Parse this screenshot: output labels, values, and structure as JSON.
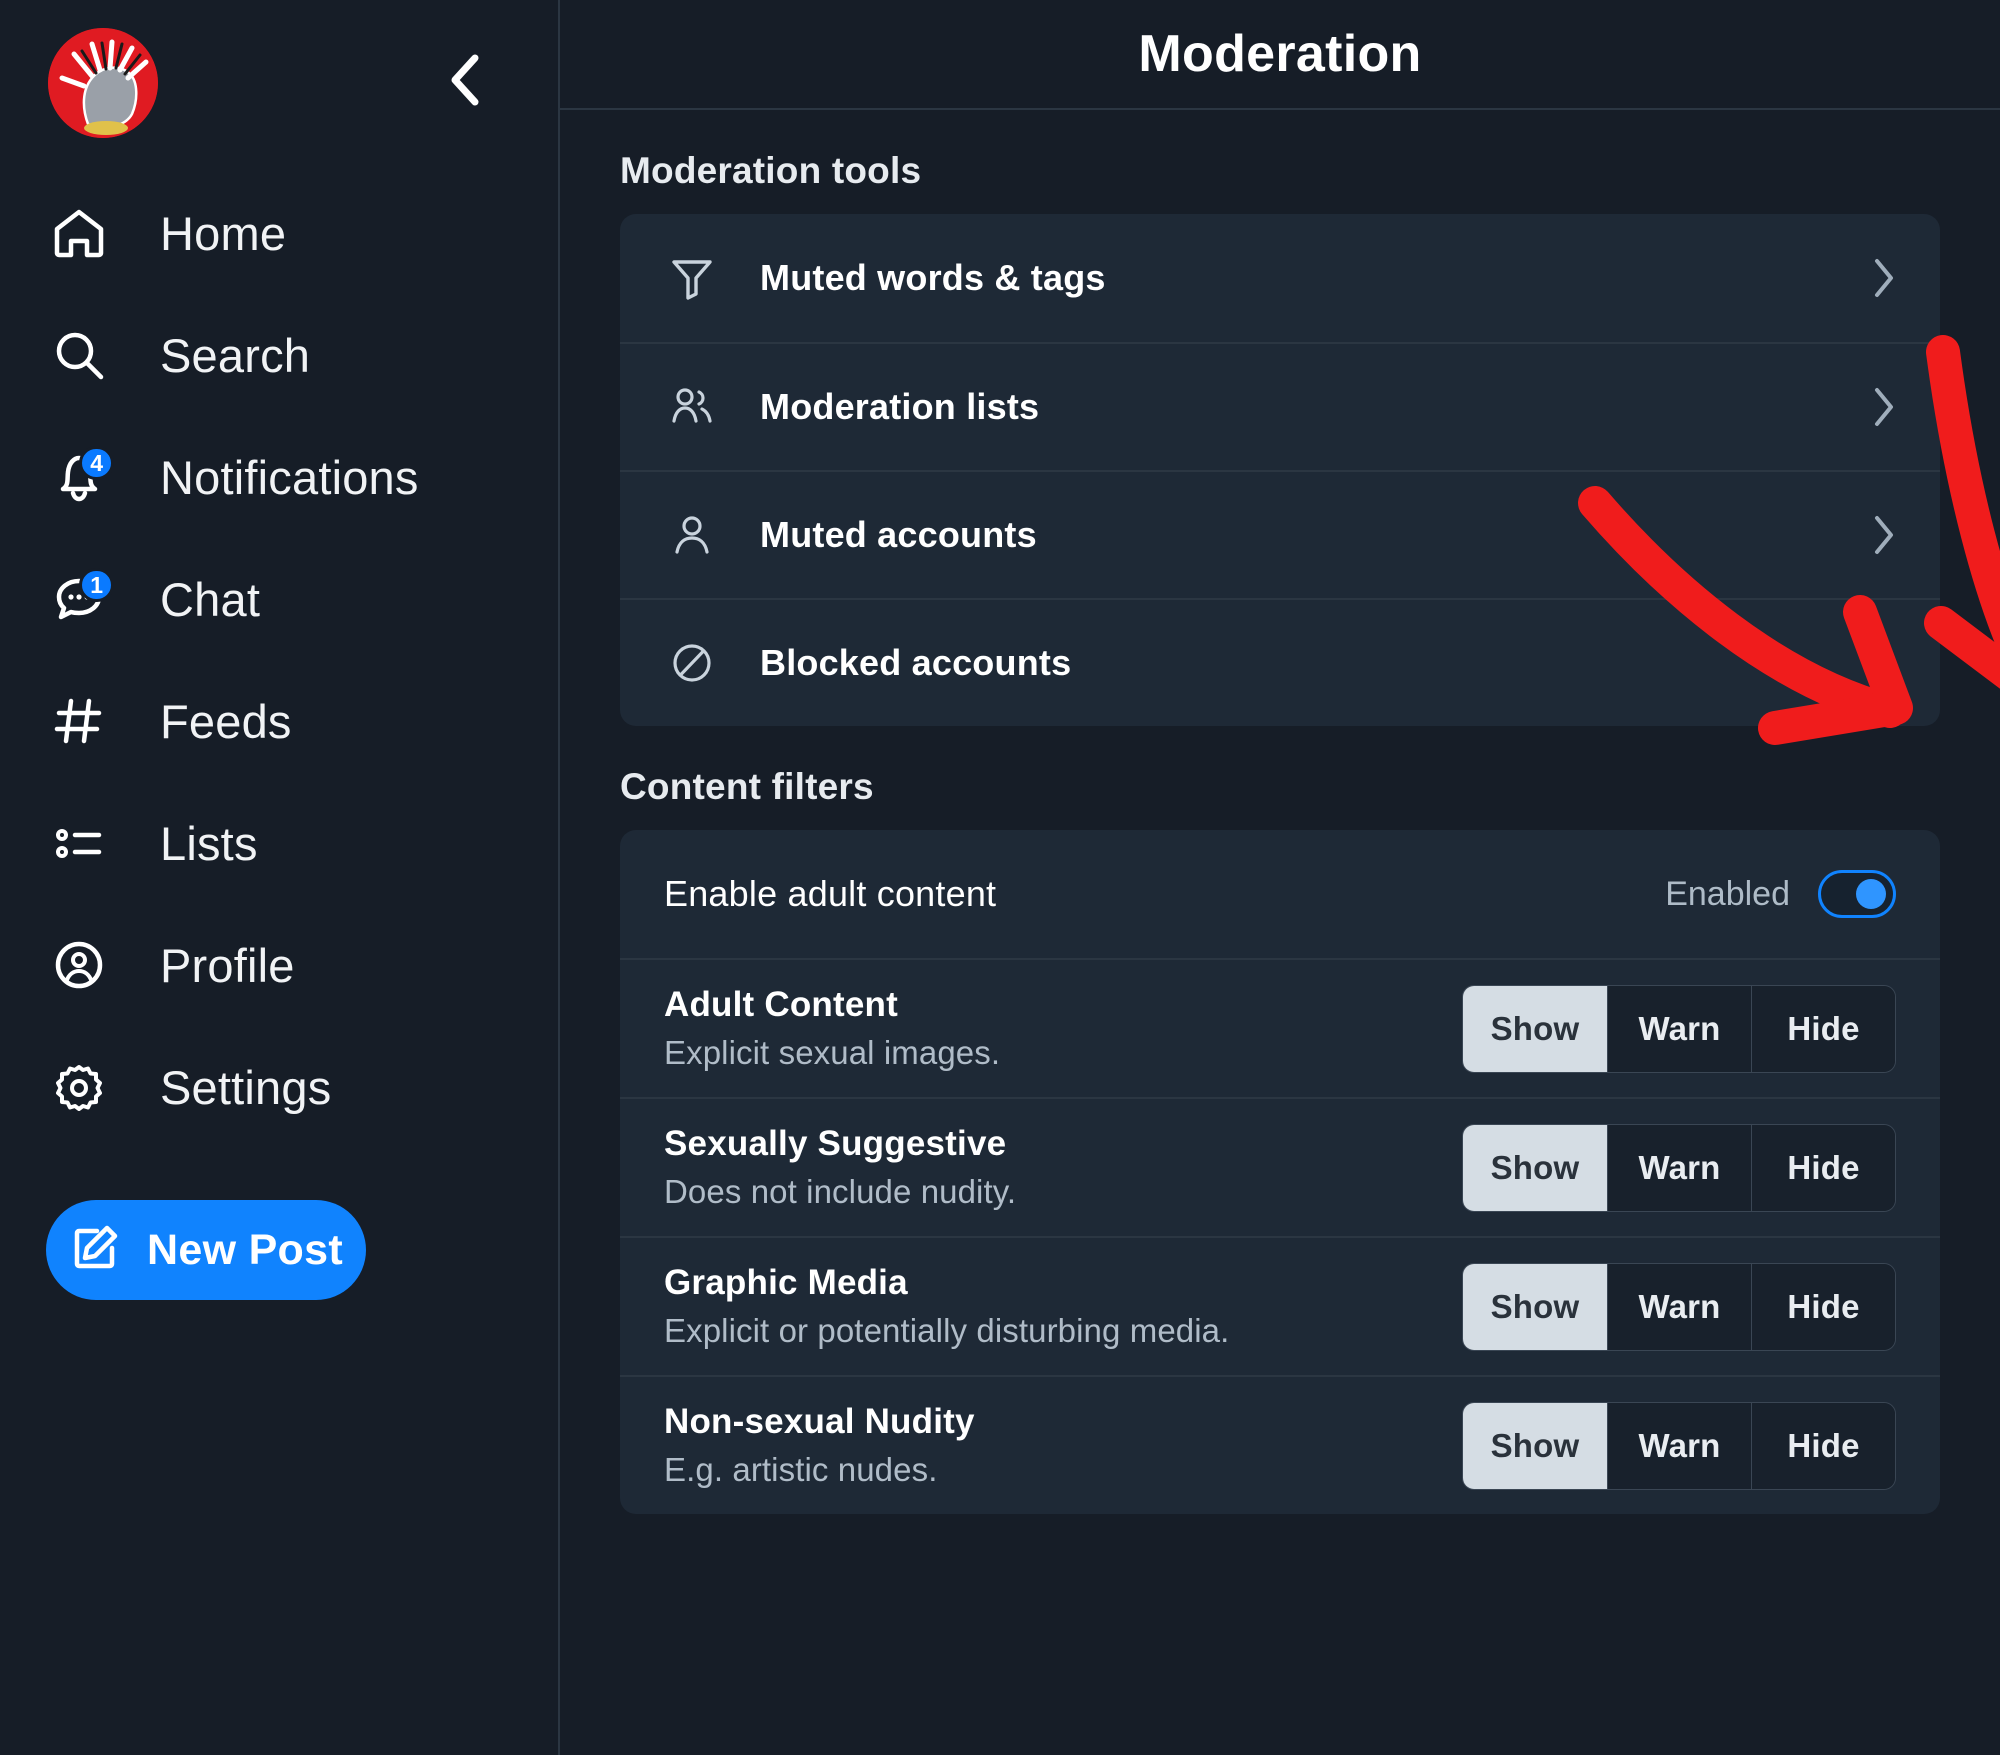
{
  "sidebar": {
    "avatar_name": "user-avatar",
    "back_label": "Back",
    "items": [
      {
        "label": "Home",
        "icon": "home-icon",
        "badge": ""
      },
      {
        "label": "Search",
        "icon": "search-icon",
        "badge": ""
      },
      {
        "label": "Notifications",
        "icon": "bell-icon",
        "badge": "4"
      },
      {
        "label": "Chat",
        "icon": "chat-bubble-icon",
        "badge": "1"
      },
      {
        "label": "Feeds",
        "icon": "hashtag-icon",
        "badge": ""
      },
      {
        "label": "Lists",
        "icon": "list-icon",
        "badge": ""
      },
      {
        "label": "Profile",
        "icon": "user-circle-icon",
        "badge": ""
      },
      {
        "label": "Settings",
        "icon": "gear-icon",
        "badge": ""
      }
    ],
    "new_post_label": "New Post"
  },
  "header": {
    "title": "Moderation"
  },
  "moderation_tools": {
    "heading": "Moderation tools",
    "rows": [
      {
        "label": "Muted words & tags",
        "icon": "filter-funnel-icon"
      },
      {
        "label": "Moderation lists",
        "icon": "users-group-icon"
      },
      {
        "label": "Muted accounts",
        "icon": "user-icon"
      },
      {
        "label": "Blocked accounts",
        "icon": "block-circle-slash-icon"
      }
    ]
  },
  "content_filters": {
    "heading": "Content filters",
    "enable_adult": {
      "label": "Enable adult content",
      "state_label": "Enabled",
      "enabled": true
    },
    "options": [
      "Show",
      "Warn",
      "Hide"
    ],
    "rows": [
      {
        "name": "Adult Content",
        "description": "Explicit sexual images.",
        "selected": "Show"
      },
      {
        "name": "Sexually Suggestive",
        "description": "Does not include nudity.",
        "selected": "Show"
      },
      {
        "name": "Graphic Media",
        "description": "Explicit or potentially disturbing media.",
        "selected": "Show"
      },
      {
        "name": "Non-sexual Nudity",
        "description": "E.g. artistic nudes.",
        "selected": "Show"
      }
    ]
  },
  "annotations": {
    "arrow_1": "red-arrow-pointing-to-enabled-label",
    "arrow_2": "red-arrow-pointing-to-adult-content-toggle",
    "color": "#f01c1c"
  },
  "colors": {
    "accent": "#1083fe",
    "background": "#161d27",
    "card": "#1e2936",
    "divider": "#2b3642",
    "annotation_red": "#f01c1c"
  }
}
